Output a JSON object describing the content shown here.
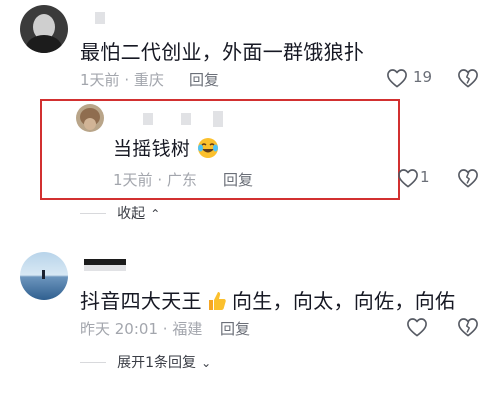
{
  "comments": [
    {
      "text": "最怕二代创业，外面一群饿狼扑",
      "time": "1天前",
      "location": "重庆",
      "reply_label": "回复",
      "like_count": "19"
    },
    {
      "text": "抖音四大天王",
      "emoji": "thumbs-up-emoji",
      "text_after": "向生，向太，向佐，向佑",
      "time": "昨天 20:01",
      "location": "福建",
      "reply_label": "回复",
      "expand_label": "展开1条回复"
    }
  ],
  "reply": {
    "text": "当摇钱树",
    "emoji": "laughing-crying-emoji",
    "time": "1天前",
    "location": "广东",
    "reply_label": "回复",
    "like_count": "1"
  },
  "collapse_label": "收起",
  "separator": "·",
  "colors": {
    "highlight": "#d23030",
    "muted": "#a3a6ad"
  }
}
